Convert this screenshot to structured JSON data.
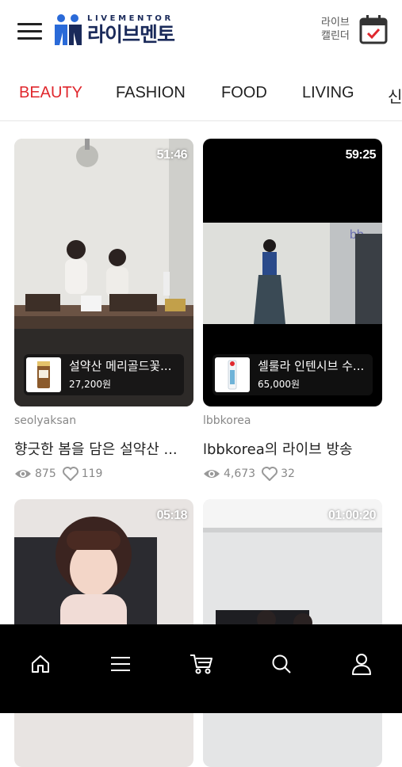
{
  "header": {
    "logo_sub": "LIVEMENTOR",
    "logo_main": "라이브멘토",
    "calendar_line1": "라이브",
    "calendar_line2": "캘린더"
  },
  "tabs": [
    {
      "label": "BEAUTY",
      "active": true
    },
    {
      "label": "FASHION",
      "active": false
    },
    {
      "label": "FOOD",
      "active": false
    },
    {
      "label": "LIVING",
      "active": false
    },
    {
      "label": "신",
      "active": false
    }
  ],
  "cards": [
    {
      "duration": "51:46",
      "product_name": "설약산 메리골드꽃...",
      "product_price": "27,200원",
      "seller": "seolyaksan",
      "title": "향긋한 봄을 담은 설약산 ...",
      "views": "875",
      "likes": "119"
    },
    {
      "duration": "59:25",
      "product_name": "셀룰라 인텐시브 수...",
      "product_price": "65,000원",
      "seller": "lbbkorea",
      "title": "lbbkorea의 라이브 방송",
      "views": "4,673",
      "likes": "32"
    },
    {
      "duration": "05:18"
    },
    {
      "duration": "01:00:20"
    }
  ],
  "nav": [
    "home-icon",
    "menu-icon",
    "cart-icon",
    "search-icon",
    "user-icon"
  ],
  "colors": {
    "accent": "#e0282e",
    "logo": "#1a2a5a",
    "logo_person": "#2a6ad8"
  }
}
